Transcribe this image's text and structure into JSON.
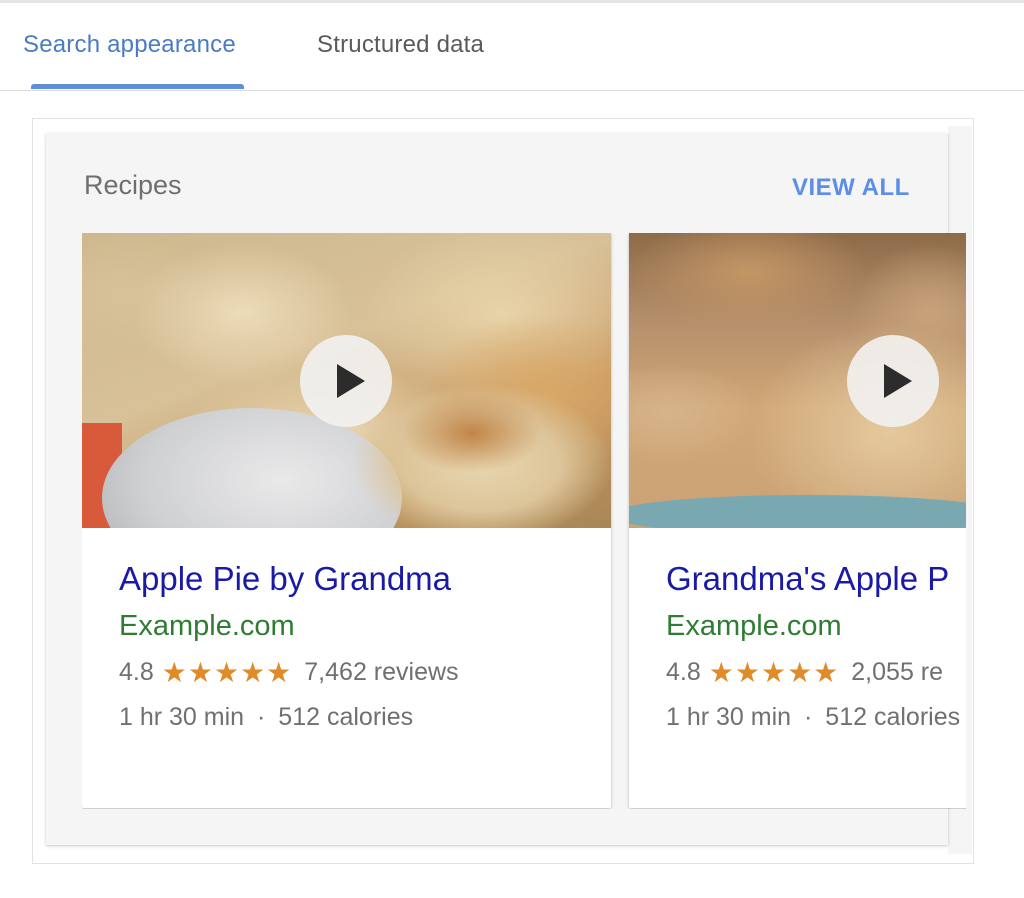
{
  "tabs": [
    {
      "label": "Search appearance",
      "active": true
    },
    {
      "label": "Structured data",
      "active": false
    }
  ],
  "panel": {
    "title": "Recipes",
    "view_all": "VIEW ALL"
  },
  "cards": [
    {
      "title": "Apple Pie by Grandma",
      "site": "Example.com",
      "rating": "4.8",
      "stars": "★★★★★",
      "reviews": "7,462 reviews",
      "time": "1 hr 30 min",
      "separator": "·",
      "calories": "512 calories"
    },
    {
      "title": "Grandma's Apple P",
      "site": "Example.com",
      "rating": "4.8",
      "stars": "★★★★★",
      "reviews": "2,055 re",
      "time": "1 hr 30 min",
      "separator": "·",
      "calories": "512 calories"
    }
  ],
  "colors": {
    "active_tab": "#4a7bc4",
    "link_title": "#1a1aa6",
    "site_green": "#2f7d32",
    "stars": "#e08b2a",
    "view_all": "#5b8ee6"
  },
  "icons": {
    "play": "play-icon",
    "star": "star-icon"
  }
}
